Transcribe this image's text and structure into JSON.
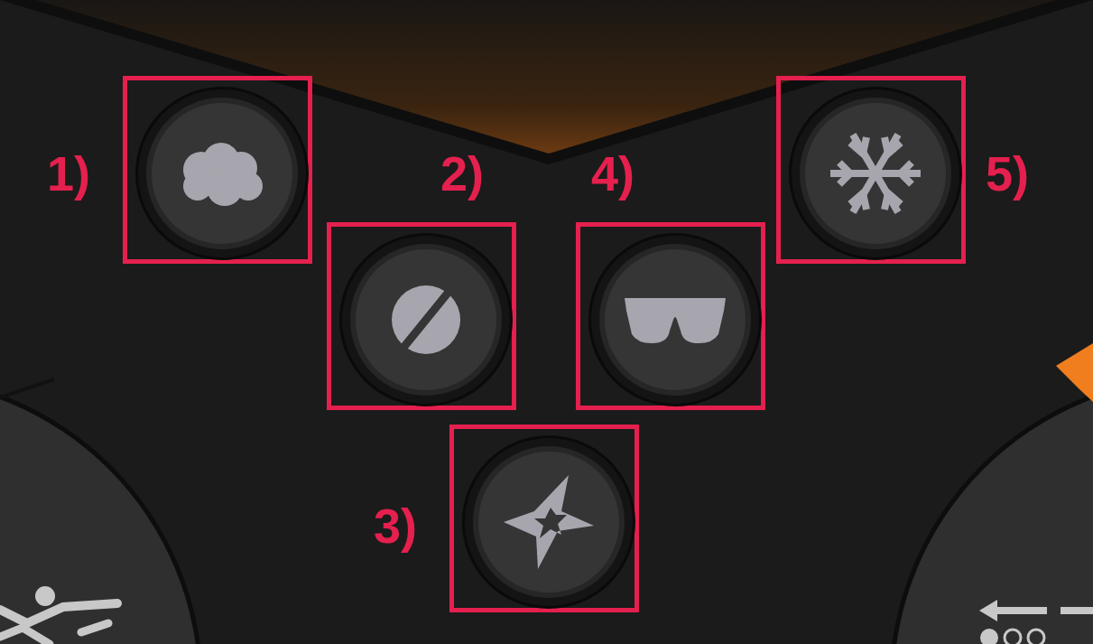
{
  "buttons": [
    {
      "label": "1)",
      "kind": "cloud"
    },
    {
      "label": "2)",
      "kind": "pill"
    },
    {
      "label": "3)",
      "kind": "star"
    },
    {
      "label": "4)",
      "kind": "glasses"
    },
    {
      "label": "5)",
      "kind": "snowflake"
    }
  ]
}
